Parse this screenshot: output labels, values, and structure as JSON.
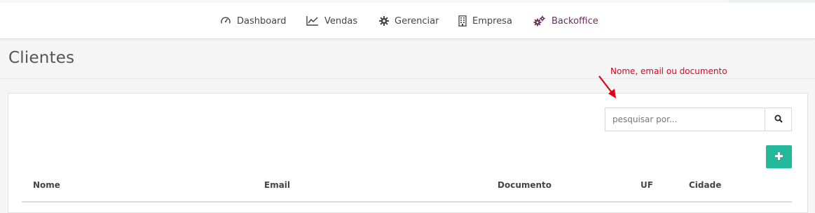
{
  "nav": {
    "items": [
      {
        "label": "Dashboard",
        "icon": "speedometer-icon"
      },
      {
        "label": "Vendas",
        "icon": "line-chart-icon"
      },
      {
        "label": "Gerenciar",
        "icon": "gear-icon"
      },
      {
        "label": "Empresa",
        "icon": "building-icon"
      },
      {
        "label": "Backoffice",
        "icon": "gears-icon"
      }
    ],
    "active": "Backoffice",
    "active_color": "#6b2c5e"
  },
  "page": {
    "title": "Clientes"
  },
  "annotation": {
    "text": "Nome, email ou documento",
    "color": "#e3001b"
  },
  "search": {
    "placeholder": "pesquisar por...",
    "value": "",
    "button_icon": "search-icon"
  },
  "add_button": {
    "icon": "plus-icon",
    "color": "#22b89a"
  },
  "table": {
    "columns": [
      "Nome",
      "Email",
      "Documento",
      "UF",
      "Cidade"
    ]
  }
}
